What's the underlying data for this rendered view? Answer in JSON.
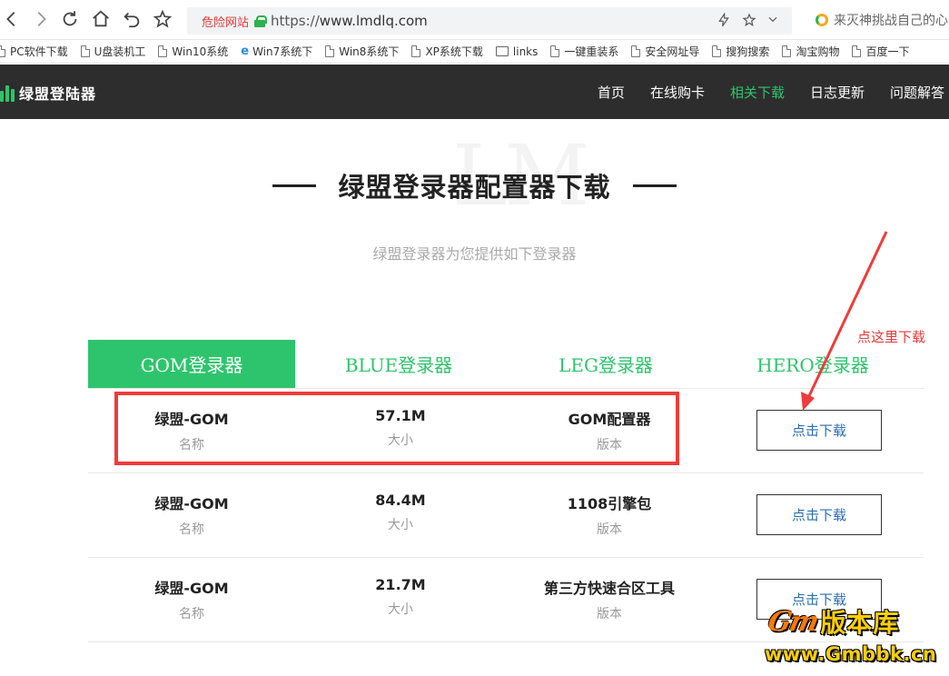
{
  "browser": {
    "address": {
      "warning": "危险网站",
      "protocol": "https://",
      "host": "www.lmdlq.com"
    },
    "search_hint": "来灭神挑战自己的心"
  },
  "bookmarks": [
    {
      "label": "PC软件下载",
      "icon": "page"
    },
    {
      "label": "U盘装机工",
      "icon": "page"
    },
    {
      "label": "Win10系统",
      "icon": "page"
    },
    {
      "label": "Win7系统下",
      "icon": "ie"
    },
    {
      "label": "Win8系统下",
      "icon": "page"
    },
    {
      "label": "XP系统下载",
      "icon": "page"
    },
    {
      "label": "links",
      "icon": "folder"
    },
    {
      "label": "一键重装系",
      "icon": "page"
    },
    {
      "label": "安全网址导",
      "icon": "page"
    },
    {
      "label": "搜狗搜索",
      "icon": "page"
    },
    {
      "label": "淘宝购物",
      "icon": "page"
    },
    {
      "label": "百度一下",
      "icon": "page"
    }
  ],
  "site": {
    "logo": "绿盟登陆器",
    "menu": [
      "首页",
      "在线购卡",
      "相关下载",
      "日志更新",
      "问题解答"
    ],
    "active_menu": "相关下载",
    "accent": "#2ec46d",
    "header_bg": "#2d2d2d"
  },
  "page": {
    "bg_mark": "LM",
    "title": "绿盟登录器配置器下载",
    "subtitle": "绿盟登录器为您提供如下登录器"
  },
  "tabs": [
    "GOM登录器",
    "BLUE登录器",
    "LEG登录器",
    "HERO登录器"
  ],
  "active_tab": "GOM登录器",
  "rows": [
    {
      "name": "绿盟-GOM",
      "name_label": "名称",
      "size": "57.1M",
      "size_label": "大小",
      "version": "GOM配置器",
      "version_label": "版本",
      "button": "点击下载"
    },
    {
      "name": "绿盟-GOM",
      "name_label": "名称",
      "size": "84.4M",
      "size_label": "大小",
      "version": "1108引擎包",
      "version_label": "版本",
      "button": "点击下载"
    },
    {
      "name": "绿盟-GOM",
      "name_label": "名称",
      "size": "21.7M",
      "size_label": "大小",
      "version": "第三方快速合区工具",
      "version_label": "版本",
      "button": "点击下载"
    }
  ],
  "annotation": {
    "text": "点这里下载",
    "color": "#ef3b3b"
  },
  "watermark": {
    "brand": "Gm",
    "title": "版本库",
    "url": "www.Gmbbk.cn"
  }
}
